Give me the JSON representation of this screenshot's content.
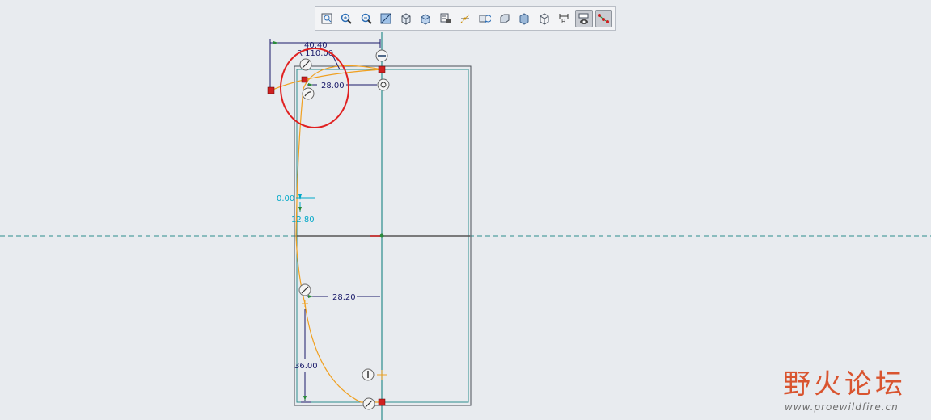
{
  "toolbar": {
    "buttons": [
      {
        "icon": "refit-icon"
      },
      {
        "icon": "zoom-in-icon"
      },
      {
        "icon": "zoom-out-icon"
      },
      {
        "icon": "repaint-icon"
      },
      {
        "icon": "display-style-icon"
      },
      {
        "icon": "saved-orientations-icon"
      },
      {
        "icon": "view-manager-icon"
      },
      {
        "icon": "datum-display-icon"
      },
      {
        "icon": "spin-center-icon"
      },
      {
        "icon": "sketch-view-icon"
      },
      {
        "icon": "shaded-view-icon"
      },
      {
        "icon": "wireframe-icon"
      },
      {
        "icon": "dimension-display-icon"
      },
      {
        "icon": "constraint-display-icon"
      },
      {
        "icon": "vertex-display-icon"
      }
    ]
  },
  "sketch": {
    "dimensions": {
      "width_top": "40.40",
      "radius": "R 110.00",
      "top_horizontal": "28.00",
      "left_zero": "0.00",
      "left_vertical": "12.80",
      "bottom_horizontal": "28.20",
      "bottom_vertical": "36.00"
    }
  },
  "watermark": {
    "text": "野火论坛",
    "url": "www.proewildfire.cn"
  },
  "colors": {
    "background": "#e8ebef",
    "sketch_line": "#2c8c8c",
    "spline": "#f0a020",
    "annotation": "#e02020",
    "dimension": "#1a1a6a",
    "weak_dimension": "#00a8c8"
  }
}
